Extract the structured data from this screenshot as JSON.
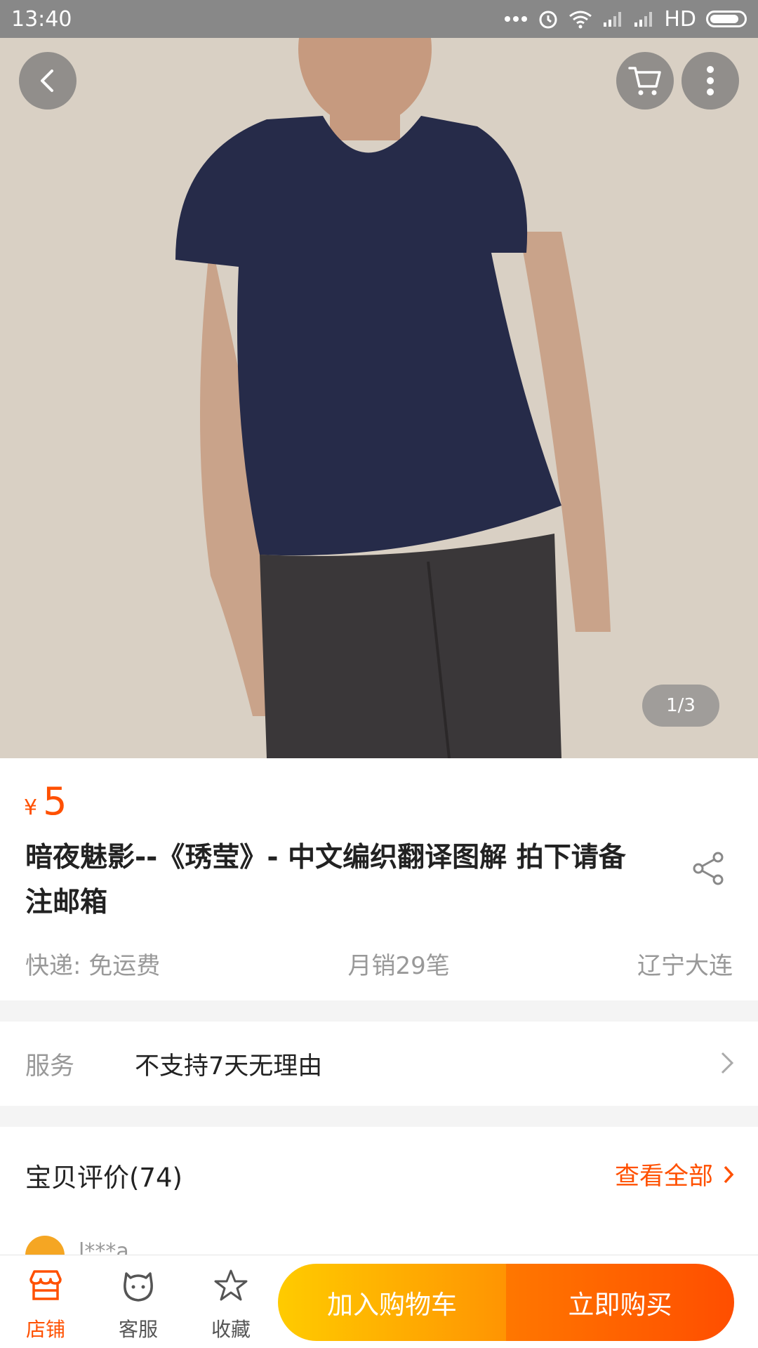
{
  "status_bar": {
    "time": "13:40",
    "signal_text": "HD",
    "icons": [
      "dots-icon",
      "alarm-icon",
      "wifi-icon",
      "signal-icon",
      "signal-icon",
      "battery-icon"
    ]
  },
  "header": {
    "icons": [
      "back-icon",
      "cart-icon",
      "more-icon"
    ]
  },
  "gallery": {
    "indicator": "1/3"
  },
  "product": {
    "currency": "¥",
    "price": "5",
    "title": "暗夜魅影--《琇莹》- 中文编织翻译图解 拍下请备注邮箱",
    "shipping": "快递: 免运费",
    "monthly_sales": "月销29笔",
    "location": "辽宁大连"
  },
  "service": {
    "label": "服务",
    "value": "不支持7天无理由"
  },
  "reviews": {
    "title": "宝贝评价(74)",
    "view_all": "查看全部",
    "first_reviewer": "l***a"
  },
  "bottom_bar": {
    "store": "店铺",
    "customer_service": "客服",
    "favorite": "收藏",
    "add_to_cart": "加入购物车",
    "buy_now": "立即购买"
  },
  "colors": {
    "accent": "#ff5000",
    "add_cart_start": "#ffcb00",
    "add_cart_end": "#ff9402",
    "buy_start": "#ff7700",
    "buy_end": "#ff4e00"
  }
}
